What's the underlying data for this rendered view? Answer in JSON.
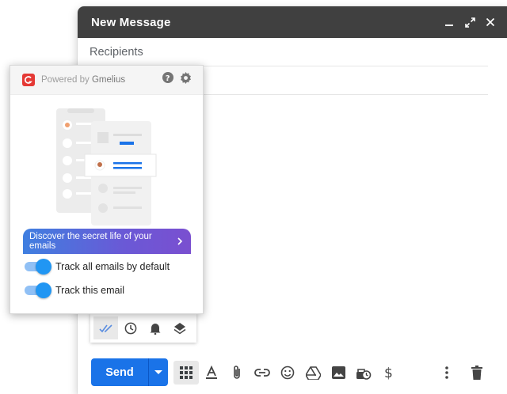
{
  "compose": {
    "title": "New Message",
    "recipients_placeholder": "Recipients",
    "subject_placeholder": "",
    "send_label": "Send"
  },
  "header_icons": [
    "minimize-icon",
    "expand-icon",
    "close-icon"
  ],
  "toolbar_icons": [
    "apps-grid-icon",
    "formatting-icon",
    "attach-icon",
    "link-icon",
    "emoji-icon",
    "drive-icon",
    "photo-icon",
    "confidential-mode-icon",
    "dollar-icon"
  ],
  "toolbar_right_icons": [
    "more-options-icon",
    "trash-icon"
  ],
  "gmelius_toolbar": [
    "tracking-check-icon",
    "schedule-clock-icon",
    "reminder-bell-icon",
    "layers-icon"
  ],
  "popup": {
    "powered_by": "Powered by",
    "brand": "Gmelius",
    "banner_text": "Discover the secret life of your emails",
    "toggles": [
      {
        "label": "Track all emails by default",
        "on": true
      },
      {
        "label": "Track this email",
        "on": true
      }
    ]
  },
  "colors": {
    "header_bg": "#404040",
    "send_blue": "#1a73e8",
    "toggle_on": "#2196f3",
    "brand_red": "#e53935"
  }
}
